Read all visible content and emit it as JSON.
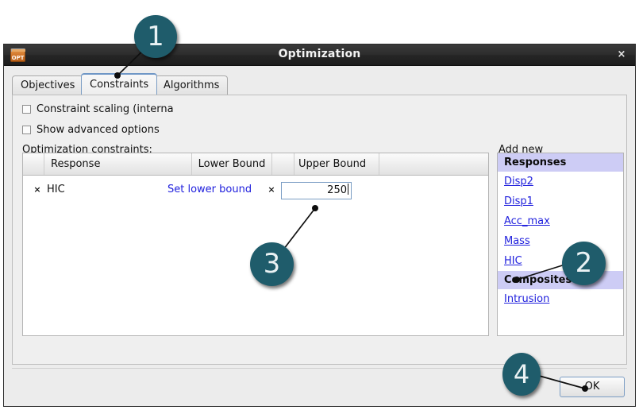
{
  "window": {
    "title": "Optimization",
    "app_icon": "opt-folder-icon",
    "icon_label": "OPT",
    "close_label": "×"
  },
  "tabs": [
    {
      "label": "Objectives",
      "selected": false
    },
    {
      "label": "Constraints",
      "selected": true
    },
    {
      "label": "Algorithms",
      "selected": false
    }
  ],
  "options": {
    "constraint_scaling": "Constraint scaling (interna",
    "show_advanced": "Show advanced options"
  },
  "constraints_section": {
    "label": "Optimization constraints:",
    "columns": [
      "Response",
      "Lower Bound",
      "Upper Bound"
    ],
    "rows": [
      {
        "delete": "×",
        "response": "HIC",
        "lower_bound_link": "Set lower bound",
        "upper_delete": "×",
        "upper_bound_value": "250"
      }
    ]
  },
  "add_new": {
    "label": "Add new",
    "groups": [
      {
        "header": "Responses",
        "items": [
          "Disp2",
          "Disp1",
          "Acc_max",
          "Mass",
          "HIC"
        ]
      },
      {
        "header": "Composites",
        "items": [
          "Intrusion"
        ]
      }
    ]
  },
  "footer": {
    "ok_label": "OK"
  },
  "callouts": [
    {
      "number": "1"
    },
    {
      "number": "2"
    },
    {
      "number": "3"
    },
    {
      "number": "4"
    }
  ],
  "colors": {
    "callout": "#1f5c6b",
    "link": "#2020dd",
    "group_header": "#cdccf5",
    "titlebar": "#2d2d2d",
    "accent_border": "#7b9dc4"
  }
}
